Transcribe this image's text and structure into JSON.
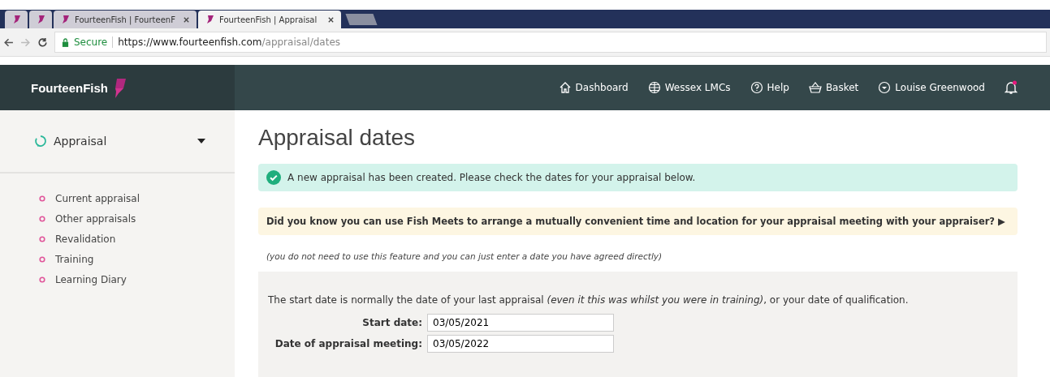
{
  "browser": {
    "tabs": [
      {
        "selected": false
      },
      {
        "selected": false
      },
      {
        "label": "FourteenFish | FourteenF",
        "selected": false
      },
      {
        "label": "FourteenFish | Appraisal",
        "selected": true
      }
    ],
    "secure_label": "Secure",
    "url_host": "https://www.fourteenfish.com",
    "url_path": "/appraisal/dates"
  },
  "header": {
    "logo": "FourteenFish",
    "nav": [
      {
        "kind": "home",
        "label": "Dashboard"
      },
      {
        "kind": "globe",
        "label": "Wessex LMCs"
      },
      {
        "kind": "help",
        "label": "Help"
      },
      {
        "kind": "basket",
        "label": "Basket"
      },
      {
        "kind": "user",
        "label": "Louise Greenwood"
      }
    ],
    "notification_dot": true
  },
  "sidebar": {
    "section": "Appraisal",
    "items": [
      "Current appraisal",
      "Other appraisals",
      "Revalidation",
      "Training",
      "Learning Diary"
    ]
  },
  "main": {
    "title": "Appraisal dates",
    "success": "A new appraisal has been created. Please check the dates for your appraisal below.",
    "tip": "Did you know you can use Fish Meets to arrange a mutually convenient time and location for your appraisal meeting with your appraiser? ▶",
    "note": "(you do not need to use this feature and you can just enter a date you have agreed directly)",
    "intro": "The start date is normally the date of your last appraisal *(even it this was whilst you were in training)*, or your date of qualification.",
    "fields": [
      {
        "label": "Start date:",
        "value": "03/05/2021"
      },
      {
        "label": "Date of appraisal meeting:",
        "value": "03/05/2022"
      }
    ]
  }
}
